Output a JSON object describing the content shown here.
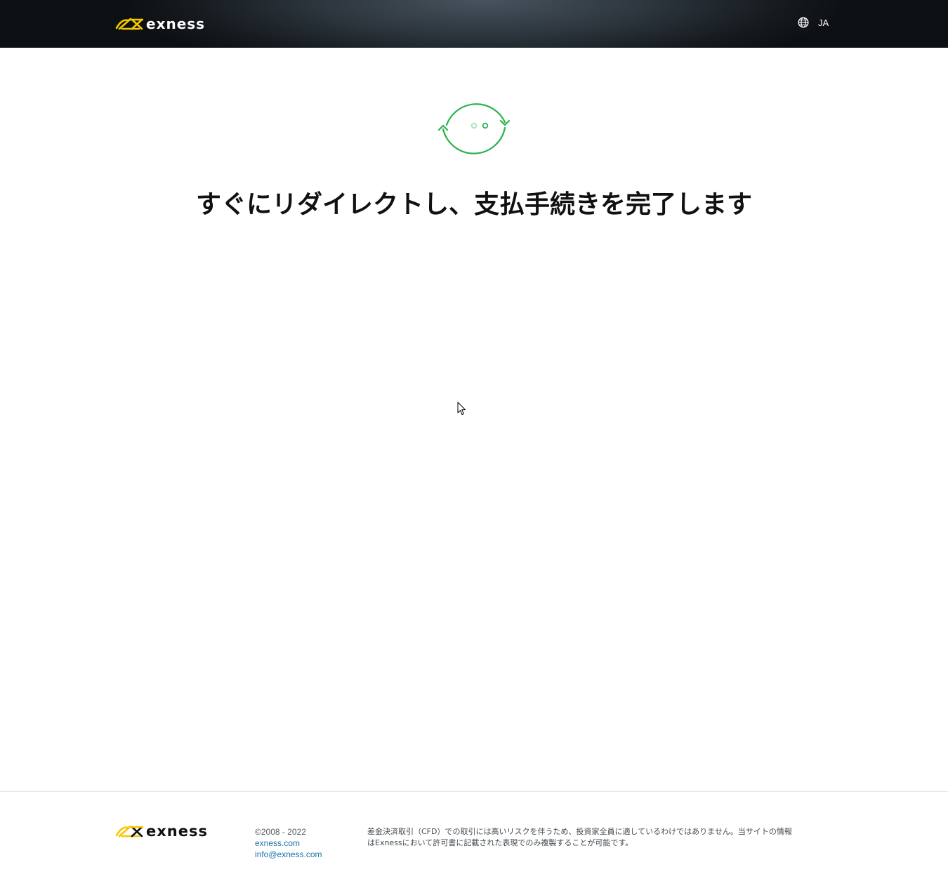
{
  "header": {
    "logo_text": "exness",
    "language": "JA",
    "language_icon": "globe-icon"
  },
  "main": {
    "loader_icon": "redirect-loader-icon",
    "headline": "すぐにリダイレクトし、支払手続きを完了します"
  },
  "footer": {
    "logo_text": "exness",
    "copyright": "©2008 - 2022",
    "site_link": "exness.com",
    "email_link": "info@exness.com",
    "disclaimer_line1": "差金決済取引（CFD）での取引には高いリスクを伴うため、投資家全員に適しているわけではありません。当サイトの情報",
    "disclaimer_line2": "はExnessにおいて許可書に記載された表現でのみ複製することが可能です。"
  },
  "colors": {
    "brand_yellow": "#f7c800",
    "loader_green": "#2bb24c",
    "link_blue": "#1a73a8"
  }
}
